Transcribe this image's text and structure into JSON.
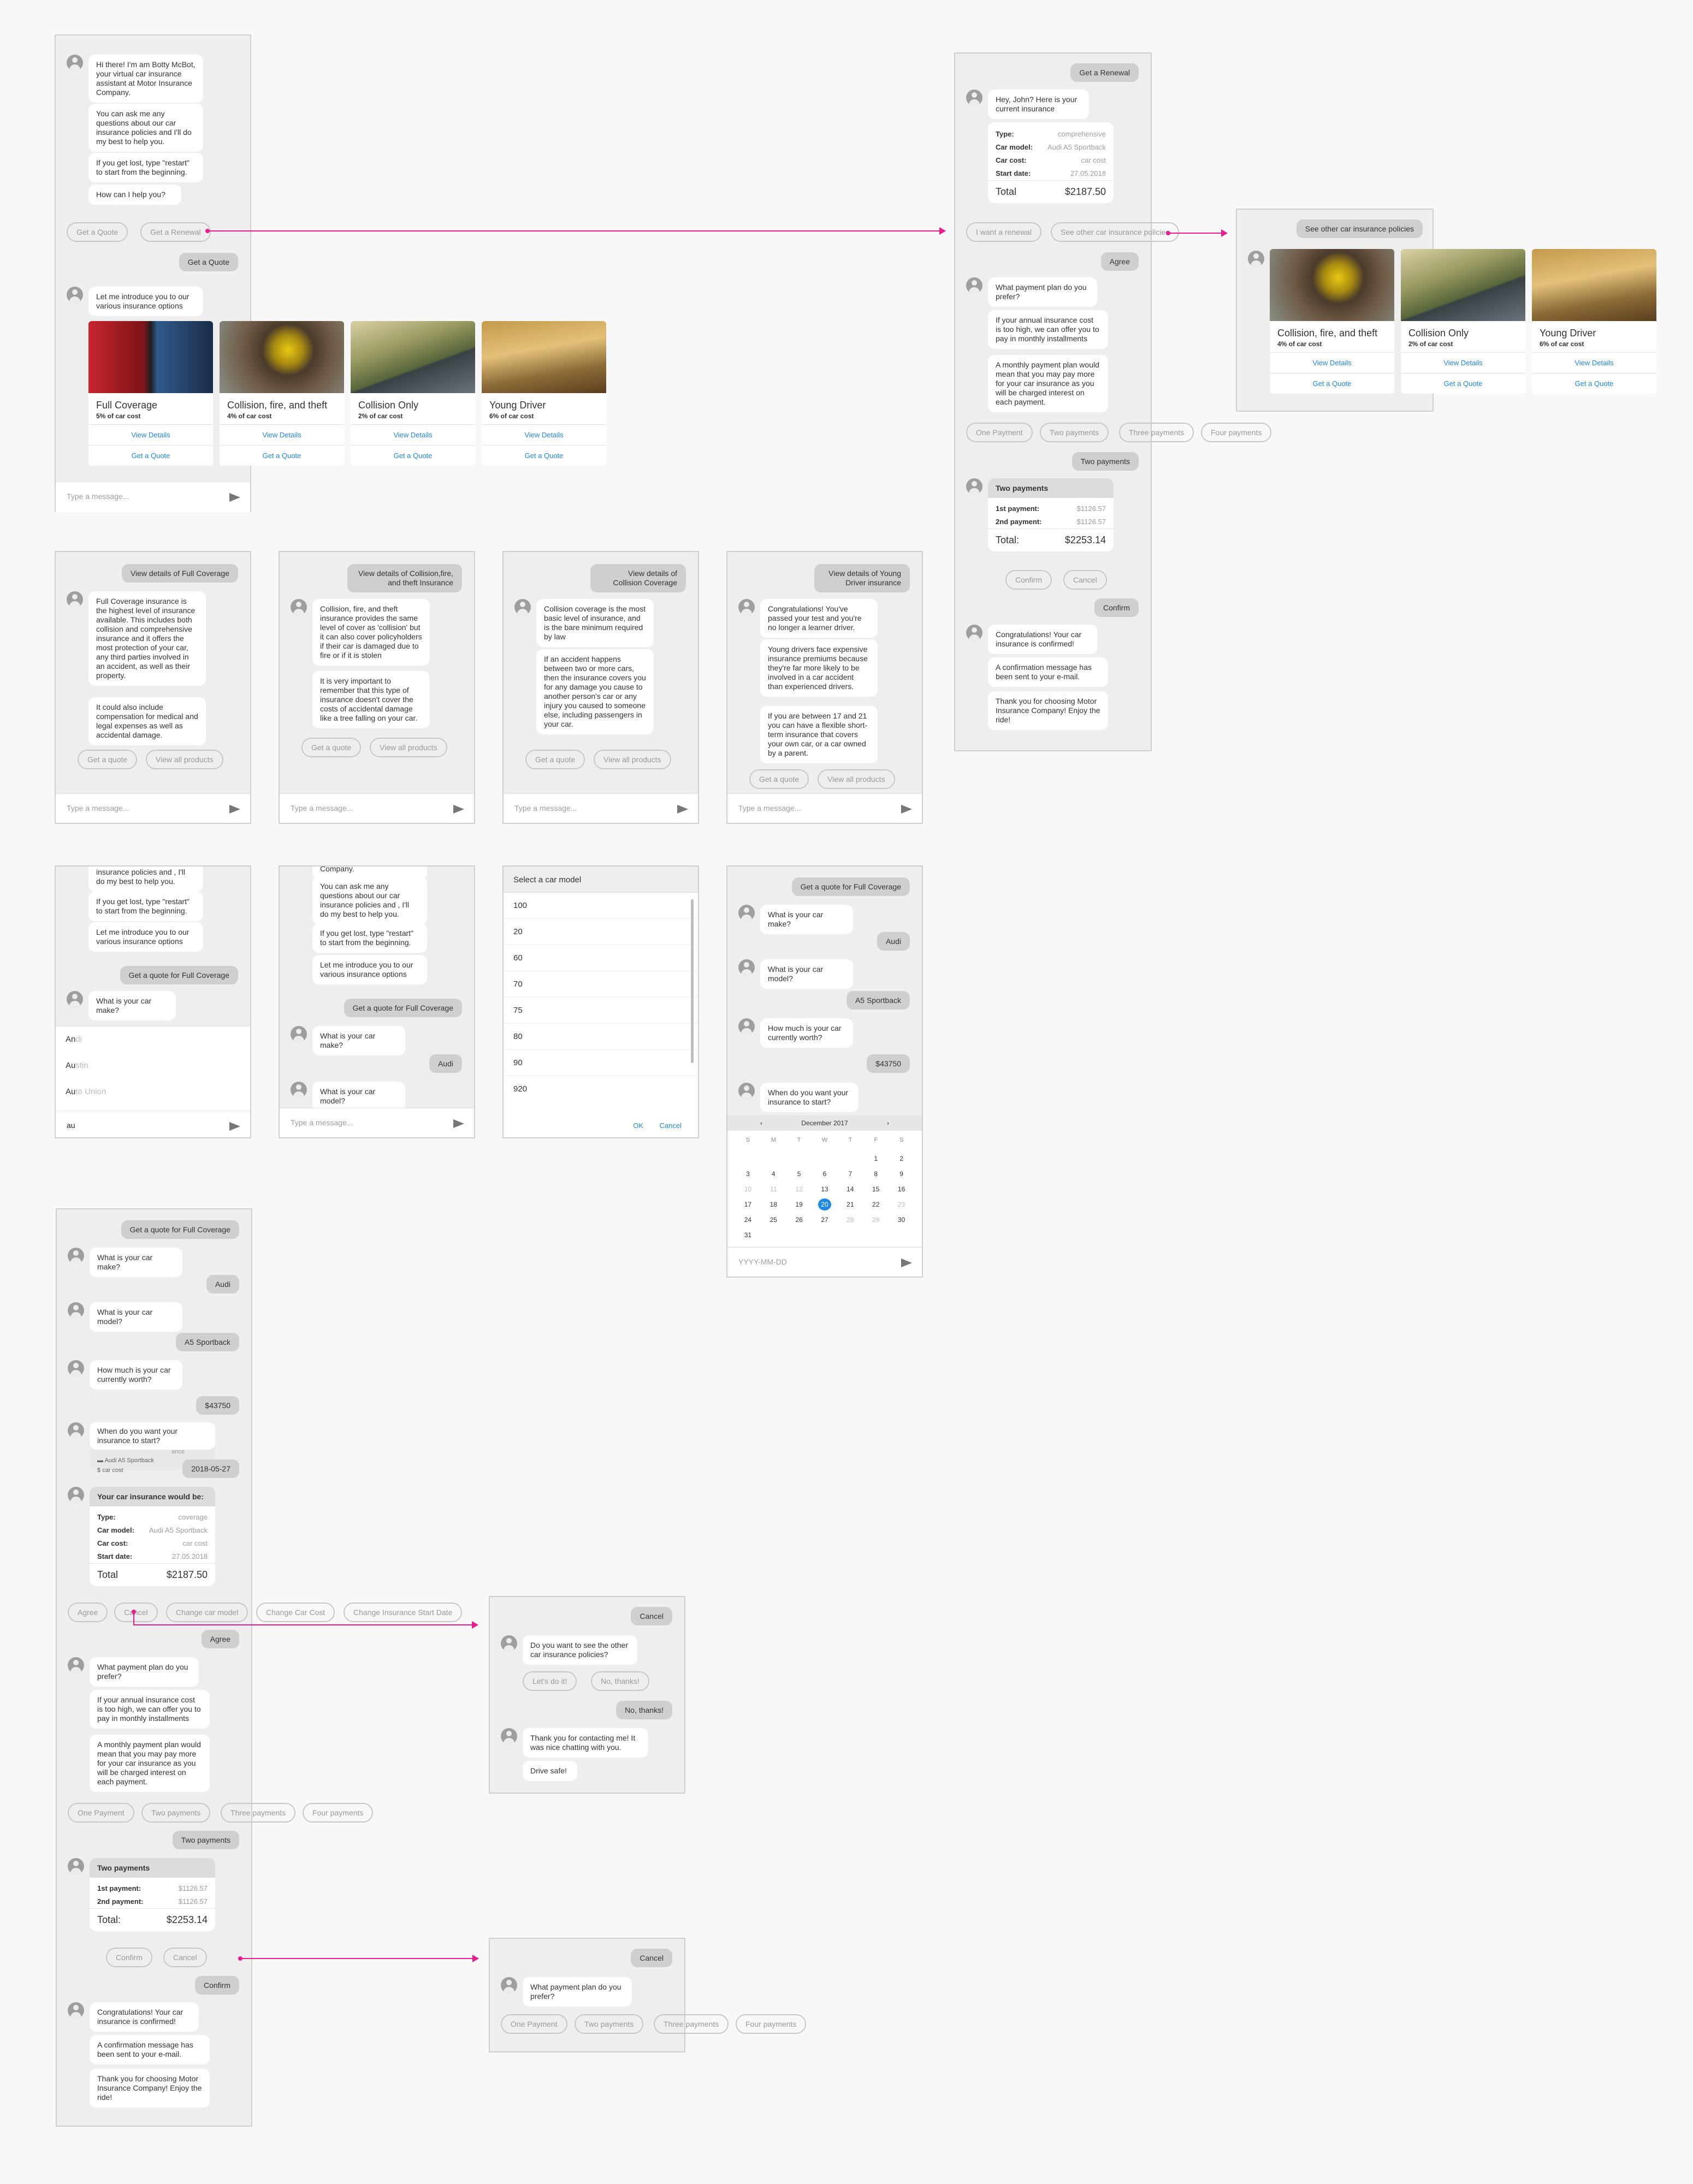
{
  "common": {
    "input_placeholder": "Type a message...",
    "date_placeholder": "YYYY-MM-DD",
    "accent": "#1e88e5",
    "flow_arrow": "#e91e8c"
  },
  "s1": {
    "intro": "Hi there! I'm am Botty McBot, your virtual car insurance assistant at Motor Insurance Company.",
    "ask": "You can ask me any questions about our car insurance policies and I'll do my best to help you.",
    "lost": "If you get lost, type \"restart\" to start from the beginning.",
    "help": "How can I help you?",
    "chip_quote": "Get a Quote",
    "chip_renewal": "Get a Renewal",
    "user_quote": "Get a Quote",
    "introduce": "Let me introduce you to our various insurance options",
    "cards": [
      {
        "title": "Full Coverage",
        "sub": "5% of car cost",
        "details": "View Details",
        "quote": "Get a Quote"
      },
      {
        "title": "Collision, fire, and theft",
        "sub": "4% of car cost",
        "details": "View Details",
        "quote": "Get a Quote"
      },
      {
        "title": "Collision Only",
        "sub": "2% of car cost",
        "details": "View Details",
        "quote": "Get a Quote"
      },
      {
        "title": "Young Driver",
        "sub": "6% of car cost",
        "details": "View Details",
        "quote": "Get a Quote"
      }
    ]
  },
  "renew": {
    "user": "Get a Renewal",
    "hey": "Hey, John? Here is your current insurance",
    "rows": [
      {
        "k": "Type:",
        "v": "comprehensive"
      },
      {
        "k": "Car model:",
        "v": "Audi A5 Sportback"
      },
      {
        "k": "Car cost:",
        "v": "car cost"
      },
      {
        "k": "Start date:",
        "v": "27.05.2018"
      }
    ],
    "total_label": "Total",
    "total": "$2187.50",
    "chip_renewal": "I want a renewal",
    "chip_other": "See other car insurance policies",
    "agree": "Agree",
    "plan_q": "What payment plan do you prefer?",
    "plan_1": "If your annual insurance cost is too high, we can offer you to pay in monthly installments",
    "plan_2": "A monthly payment plan would mean that you may pay more for your car insurance as you will be charged interest on each payment.",
    "plans": [
      "One Payment",
      "Two payments",
      "Three payments",
      "Four payments"
    ],
    "user_two": "Two payments",
    "pay_head": "Two payments",
    "pay_rows": [
      {
        "k": "1st payment:",
        "v": "$1126.57"
      },
      {
        "k": "2nd payment:",
        "v": "$1126.57"
      }
    ],
    "pay_total_label": "Total:",
    "pay_total": "$2253.14",
    "confirm": "Confirm",
    "cancel": "Cancel",
    "user_confirm": "Confirm",
    "done_1": "Congratulations! Your car insurance is confirmed!",
    "done_2": "A confirmation message has been sent to your e-mail.",
    "done_3": "Thank you for choosing Motor Insurance Company! Enjoy the ride!"
  },
  "other": {
    "user": "See other car insurance policies",
    "cards": [
      {
        "title": "Collision, fire, and theft",
        "sub": "4% of car cost",
        "details": "View Details",
        "quote": "Get a Quote"
      },
      {
        "title": "Collision Only",
        "sub": "2% of car cost",
        "details": "View Details",
        "quote": "Get a Quote"
      },
      {
        "title": "Young Driver",
        "sub": "6% of car cost",
        "details": "View Details",
        "quote": "Get a Quote"
      }
    ]
  },
  "d1": {
    "user": "View details of Full Coverage",
    "b1": "Full Coverage insurance is the highest level of insurance available. This includes both collision and comprehensive insurance and it offers the most protection of your car, any third parties involved in an accident, as well as their property.",
    "b2": "It could also include compensation for medical and legal expenses as well as accidental damage.",
    "c1": "Get a quote",
    "c2": "View all products"
  },
  "d2": {
    "user": "View details of Collision,fire, and theft Insurance",
    "b1": "Collision, fire, and theft insurance provides the same level of cover as 'collision' but it can also cover policyholders if their car is damaged due to fire or if it is stolen",
    "b2": "It is very important to remember that this type of insurance doesn't cover the costs of accidental damage like a tree falling on your car.",
    "c1": "Get a quote",
    "c2": "View all products"
  },
  "d3": {
    "user": "View details of Collision Coverage",
    "b1": "Collision coverage is the most basic level of insurance, and is the bare minimum required by law",
    "b2": "If an accident happens between two or more cars, then the insurance covers you for any damage you cause to another person's car or any injury you caused to someone else, including passengers in your car.",
    "c1": "Get a quote",
    "c2": "View all products"
  },
  "d4": {
    "user": "View details of Young Driver insurance",
    "b1": "Congratulations! You've passed your test and you're no longer a learner driver.",
    "b2": "Young drivers face expensive insurance premiums because they're far more likely to be involved in a car accident than experienced drivers.",
    "b3": "If you are between 17 and 21 you can have a flexible short-term insurance that covers your own car, or a car owned by a parent.",
    "c1": "Get a quote",
    "c2": "View all products"
  },
  "m1": {
    "top": "insurance policies and , I'll do my best to help you.",
    "lost": "If you get lost, type \"restart\" to start from the beginning.",
    "introduce": "Let me introduce you to our various insurance options",
    "user": "Get a quote for Full Coverage",
    "q": "What is your car make?",
    "sugg_typed": [
      "An",
      "Au",
      "Au"
    ],
    "sugg_rest": [
      "di",
      "stin",
      "to Union"
    ],
    "typed": "au"
  },
  "m2": {
    "top": "Company.",
    "ask": "You can ask me any questions about our car insurance policies and , I'll do my best to help you.",
    "lost": "If you get lost, type \"restart\" to start from the beginning.",
    "introduce": "Let me introduce you to our various insurance options",
    "user": "Get a quote for Full Coverage",
    "q1": "What is your car make?",
    "audi": "Audi",
    "q2": "What is your car model?"
  },
  "m3": {
    "title": "Select a car model",
    "items": [
      "100",
      "20",
      "60",
      "70",
      "75",
      "80",
      "90",
      "920"
    ],
    "ok": "OK",
    "cancel": "Cancel"
  },
  "m4": {
    "user": "Get a quote for Full Coverage",
    "q1": "What is your car make?",
    "audi": "Audi",
    "q2": "What is your car model?",
    "model": "A5 Sportback",
    "q3": "How much is your car currently worth?",
    "worth": "$43750",
    "q4": "When do you want your insurance to start?",
    "month": "December 2017",
    "days_hdr": [
      "S",
      "M",
      "T",
      "W",
      "T",
      "F",
      "S"
    ],
    "days": [
      "",
      "",
      "",
      "",
      "",
      "1",
      "2",
      "3",
      "4",
      "5",
      "6",
      "7",
      "8",
      "9",
      "10",
      "11",
      "12",
      "13",
      "14",
      "15",
      "16",
      "17",
      "18",
      "19",
      "20",
      "21",
      "22",
      "23",
      "24",
      "25",
      "26",
      "27",
      "28",
      "29",
      "30",
      "31"
    ],
    "dim": [
      10,
      11,
      12,
      23,
      28,
      29
    ],
    "selected": 20
  },
  "s5": {
    "user": "Get a quote for Full Coverage",
    "q1": "What is your car make?",
    "audi": "Audi",
    "q2": "What is your car model?",
    "model": "A5 Sportback",
    "q3": "How much is your car currently worth?",
    "worth": "$43750",
    "q4": "When do you want your insurance to start?",
    "ghost_1": "ance",
    "ghost_2": "Audi A5 Sportback",
    "ghost_3": "car cost",
    "date": "2018-05-27",
    "sum_head": "Your car insurance would be:",
    "rows": [
      {
        "k": "Type:",
        "v": "coverage"
      },
      {
        "k": "Car model:",
        "v": "Audi A5 Sportback"
      },
      {
        "k": "Car cost:",
        "v": "car cost"
      },
      {
        "k": "Start date:",
        "v": "27.05.2018"
      }
    ],
    "total_label": "Total",
    "total": "$2187.50",
    "chips": [
      "Agree",
      "Cancel",
      "Change car model",
      "Change Car Cost",
      "Change Insurance Start Date"
    ],
    "agree": "Agree",
    "plan_q": "What payment plan do you prefer?",
    "plan_1": "If your annual insurance cost is too high, we can offer you to pay in monthly installments",
    "plan_2": "A monthly payment plan would mean that you may pay more for your car insurance as you will be charged interest on each payment.",
    "plans": [
      "One Payment",
      "Two payments",
      "Three payments",
      "Four payments"
    ],
    "user_two": "Two payments",
    "pay_head": "Two payments",
    "pay_rows": [
      {
        "k": "1st payment:",
        "v": "$1126.57"
      },
      {
        "k": "2nd payment:",
        "v": "$1126.57"
      }
    ],
    "pay_total_label": "Total:",
    "pay_total": "$2253.14",
    "confirm": "Confirm",
    "cancel": "Cancel",
    "user_confirm": "Confirm",
    "done_1": "Congratulations! Your car insurance is confirmed!",
    "done_2": "A confirmation message has been sent to your e-mail.",
    "done_3": "Thank you for choosing Motor Insurance Company! Enjoy the ride!"
  },
  "c1": {
    "user": "Cancel",
    "q": "Do you want to see the other car insurance policies?",
    "yes": "Let's do it!",
    "no": "No, thanks!",
    "user_no": "No, thanks!",
    "b1": "Thank you for contacting me! It was nice chatting with you.",
    "b2": "Drive safe!"
  },
  "c2": {
    "user": "Cancel",
    "q": "What payment plan do you prefer?",
    "plans": [
      "One Payment",
      "Two payments",
      "Three payments",
      "Four payments"
    ]
  }
}
